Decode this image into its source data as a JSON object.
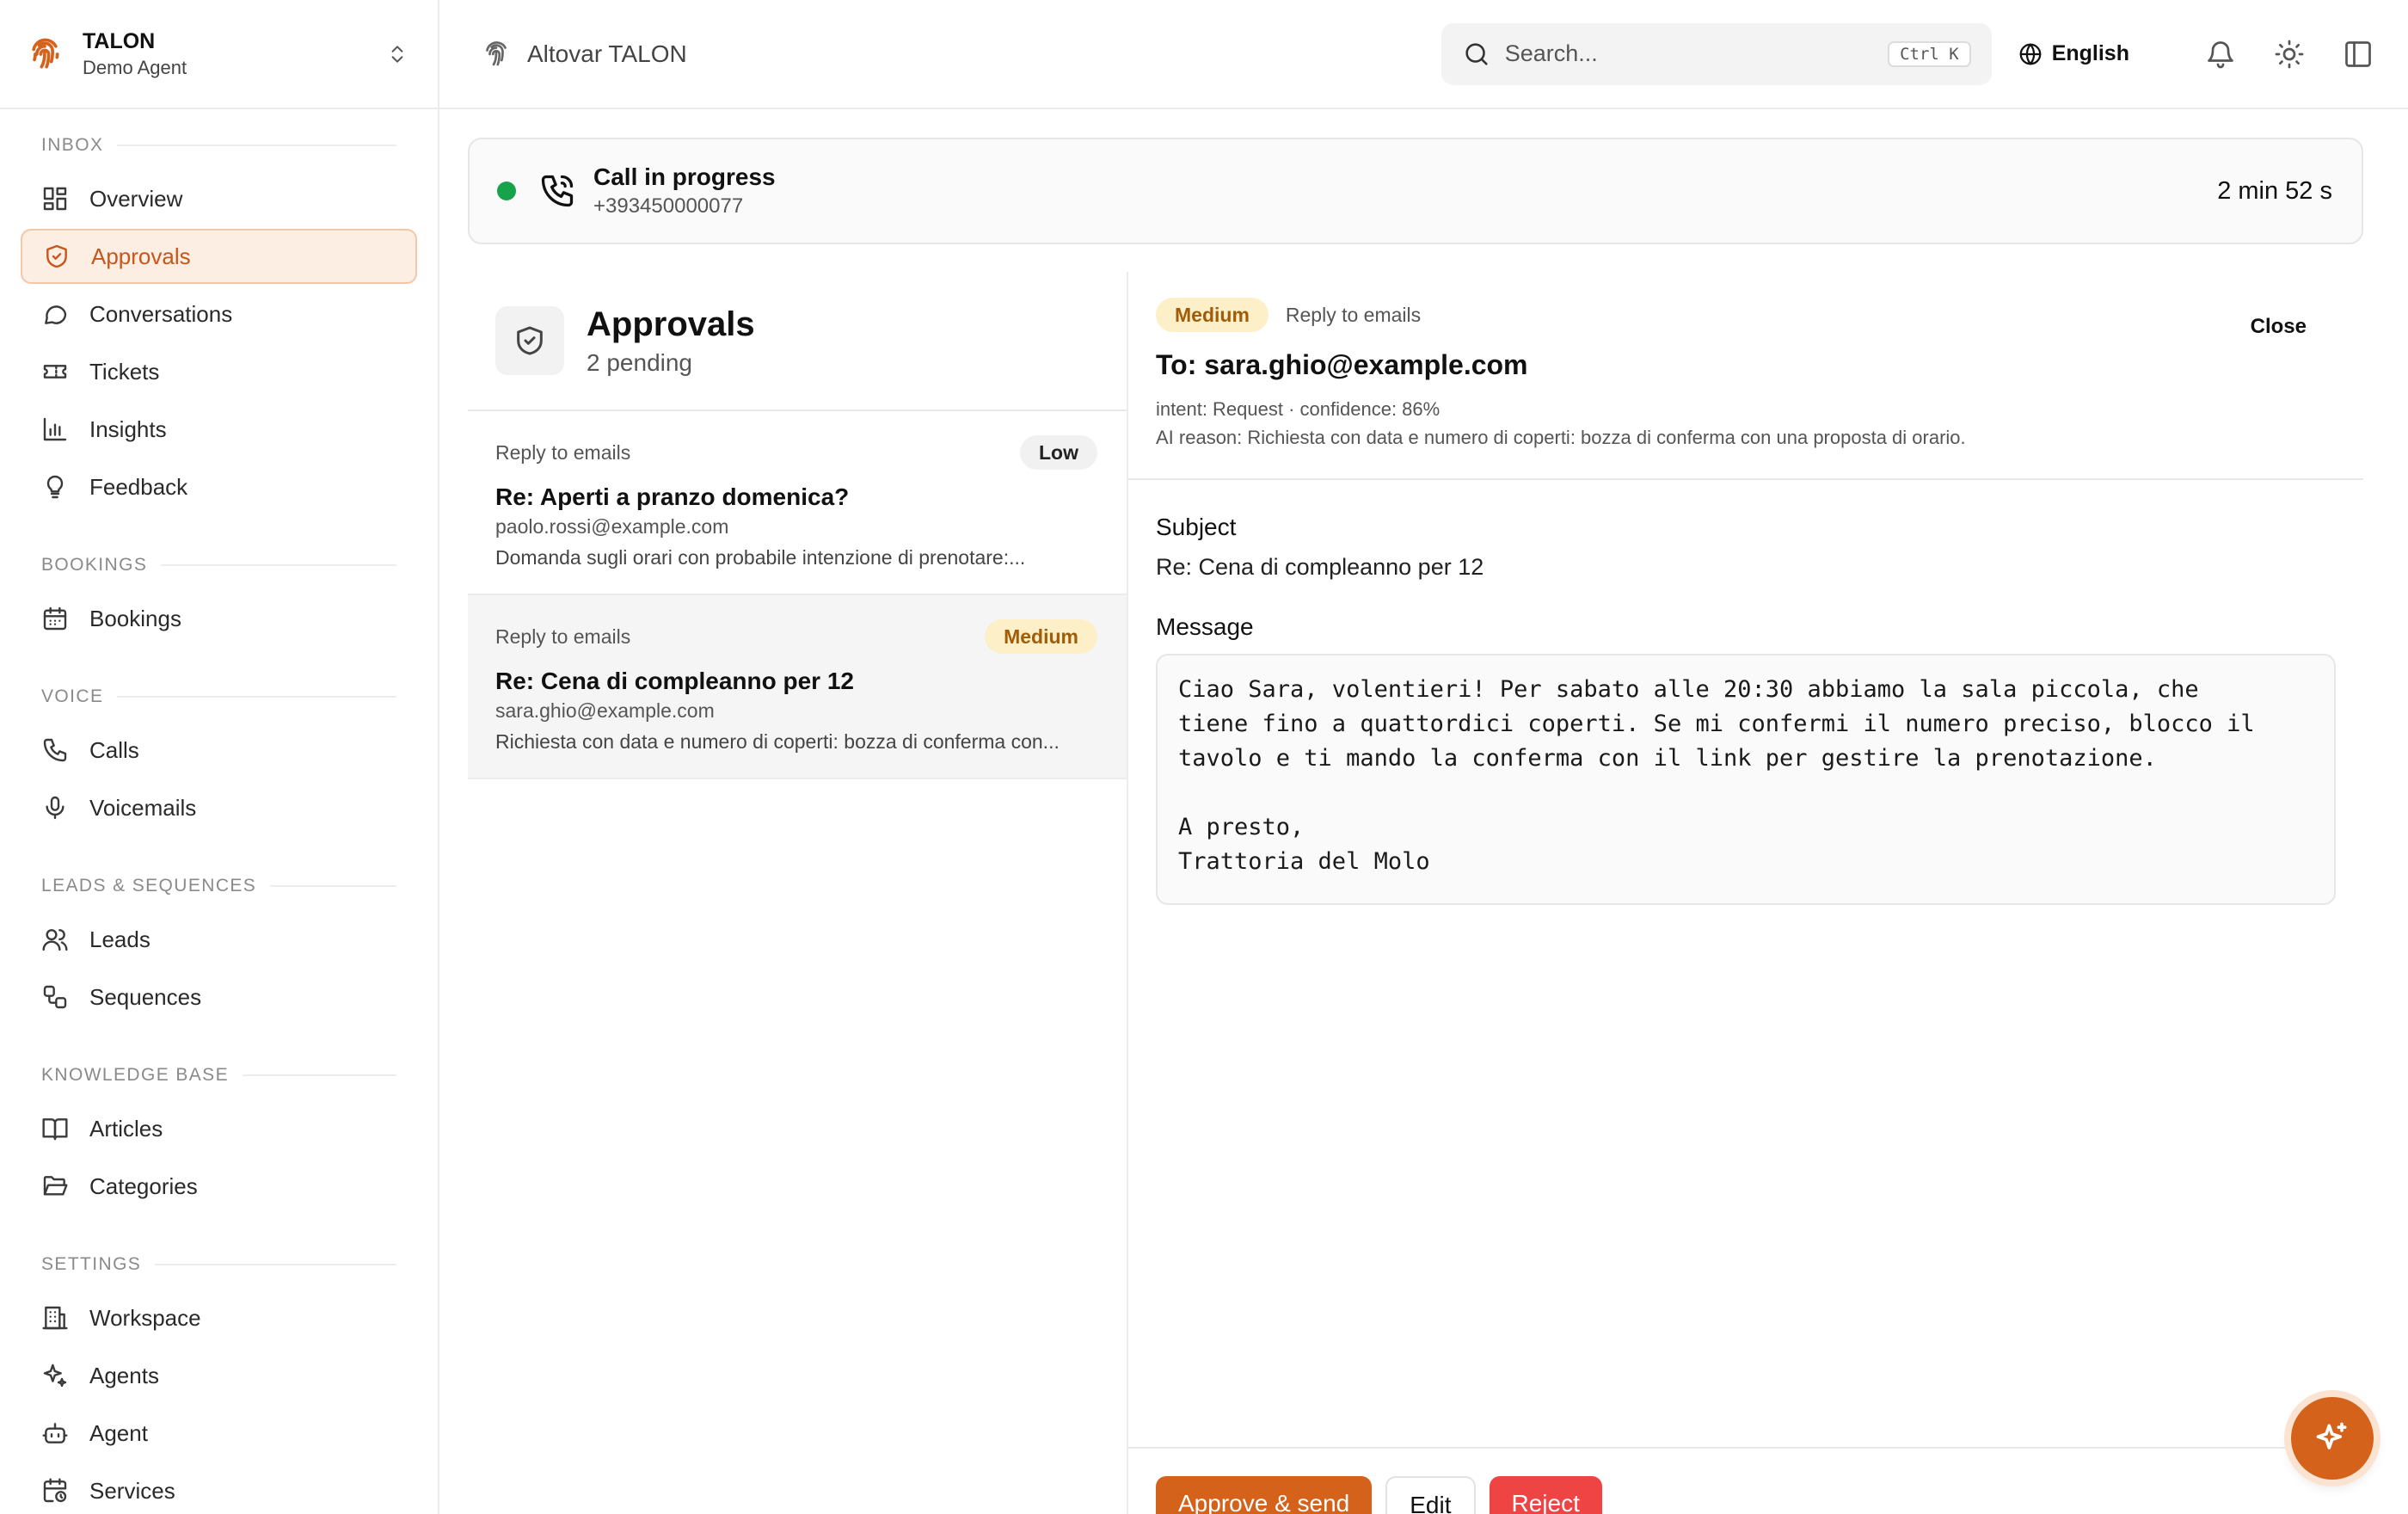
{
  "brand": {
    "name": "TALON",
    "subtitle": "Demo Agent"
  },
  "topbar": {
    "title": "Altovar TALON",
    "search_placeholder": "Search...",
    "search_shortcut": "Ctrl K",
    "language": "English"
  },
  "sidebar": {
    "sections": [
      {
        "header": "INBOX",
        "items": [
          {
            "label": "Overview",
            "icon": "grid-icon"
          },
          {
            "label": "Approvals",
            "icon": "shield-check-icon",
            "active": true
          },
          {
            "label": "Conversations",
            "icon": "chat-bubble-icon"
          },
          {
            "label": "Tickets",
            "icon": "ticket-icon"
          },
          {
            "label": "Insights",
            "icon": "bar-chart-icon"
          },
          {
            "label": "Feedback",
            "icon": "lightbulb-icon"
          }
        ]
      },
      {
        "header": "BOOKINGS",
        "items": [
          {
            "label": "Bookings",
            "icon": "calendar-icon"
          }
        ]
      },
      {
        "header": "VOICE",
        "items": [
          {
            "label": "Calls",
            "icon": "phone-icon"
          },
          {
            "label": "Voicemails",
            "icon": "microphone-icon"
          }
        ]
      },
      {
        "header": "LEADS & SEQUENCES",
        "items": [
          {
            "label": "Leads",
            "icon": "users-icon"
          },
          {
            "label": "Sequences",
            "icon": "workflow-icon"
          }
        ]
      },
      {
        "header": "KNOWLEDGE BASE",
        "items": [
          {
            "label": "Articles",
            "icon": "book-open-icon"
          },
          {
            "label": "Categories",
            "icon": "folder-open-icon"
          }
        ]
      },
      {
        "header": "SETTINGS",
        "items": [
          {
            "label": "Workspace",
            "icon": "building-icon"
          },
          {
            "label": "Agents",
            "icon": "sparkles-icon"
          },
          {
            "label": "Agent",
            "icon": "bot-icon"
          },
          {
            "label": "Services",
            "icon": "calendar-clock-icon"
          }
        ]
      }
    ]
  },
  "call": {
    "status": "Call in progress",
    "number": "+393450000077",
    "duration": "2 min 52 s",
    "status_color": "#16a34a"
  },
  "approvals": {
    "title": "Approvals",
    "pending": "2 pending",
    "items": [
      {
        "type": "Reply to emails",
        "priority": "Low",
        "subject": "Re: Aperti a pranzo domenica?",
        "from": "paolo.rossi@example.com",
        "preview": "Domanda sugli orari con probabile intenzione di prenotare:..."
      },
      {
        "type": "Reply to emails",
        "priority": "Medium",
        "subject": "Re: Cena di compleanno per 12",
        "from": "sara.ghio@example.com",
        "preview": "Richiesta con data e numero di coperti: bozza di conferma con...",
        "selected": true
      }
    ]
  },
  "detail": {
    "priority": "Medium",
    "type": "Reply to emails",
    "close_label": "Close",
    "to": "To: sara.ghio@example.com",
    "intent": "intent: Request · confidence: 86%",
    "reason": "AI reason: Richiesta con data e numero di coperti: bozza di conferma con una proposta di orario.",
    "subject_label": "Subject",
    "subject": "Re: Cena di compleanno per 12",
    "message_label": "Message",
    "message": "Ciao Sara, volentieri! Per sabato alle 20:30 abbiamo la sala piccola, che\ntiene fino a quattordici coperti. Se mi confermi il numero preciso, blocco il\ntavolo e ti mando la conferma con il link per gestire la prenotazione.\n\nA presto,\nTrattoria del Molo",
    "actions": {
      "approve": "Approve & send",
      "edit": "Edit",
      "reject": "Reject"
    }
  },
  "colors": {
    "accent": "#d4621b",
    "active_bg": "#fdeee3",
    "medium_badge_bg": "#fdf0c8",
    "danger": "#ef4444"
  }
}
